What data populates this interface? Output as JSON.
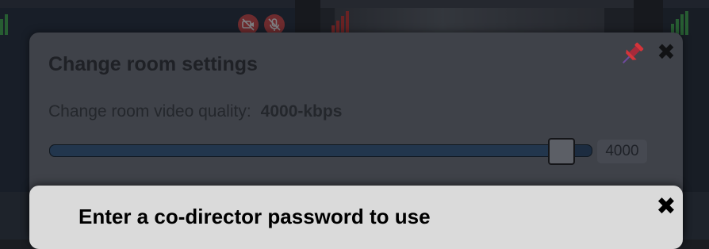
{
  "colors": {
    "dialog_bg": "#3f4249",
    "prompt_bg": "#dadada",
    "slider_track": "#1c2c40",
    "mute_red": "#d94646",
    "signal_green": "#3fb34f",
    "signal_red": "#d0312d"
  },
  "icons": {
    "pin": "pin-icon",
    "close": "close-icon",
    "camera_muted": "camera-off-icon",
    "mic_muted": "mic-off-icon",
    "signal": "signal-bars-icon"
  },
  "room_settings": {
    "title": "Change room settings",
    "quality_label": "Change room video quality:",
    "quality_value": "4000-kbps",
    "slider": {
      "min": 0,
      "max": 4150,
      "value": 4000,
      "readout": "4000"
    },
    "close_symbol": "✖"
  },
  "password_prompt": {
    "title": "Enter a co-director password to use",
    "close_symbol": "✖"
  }
}
